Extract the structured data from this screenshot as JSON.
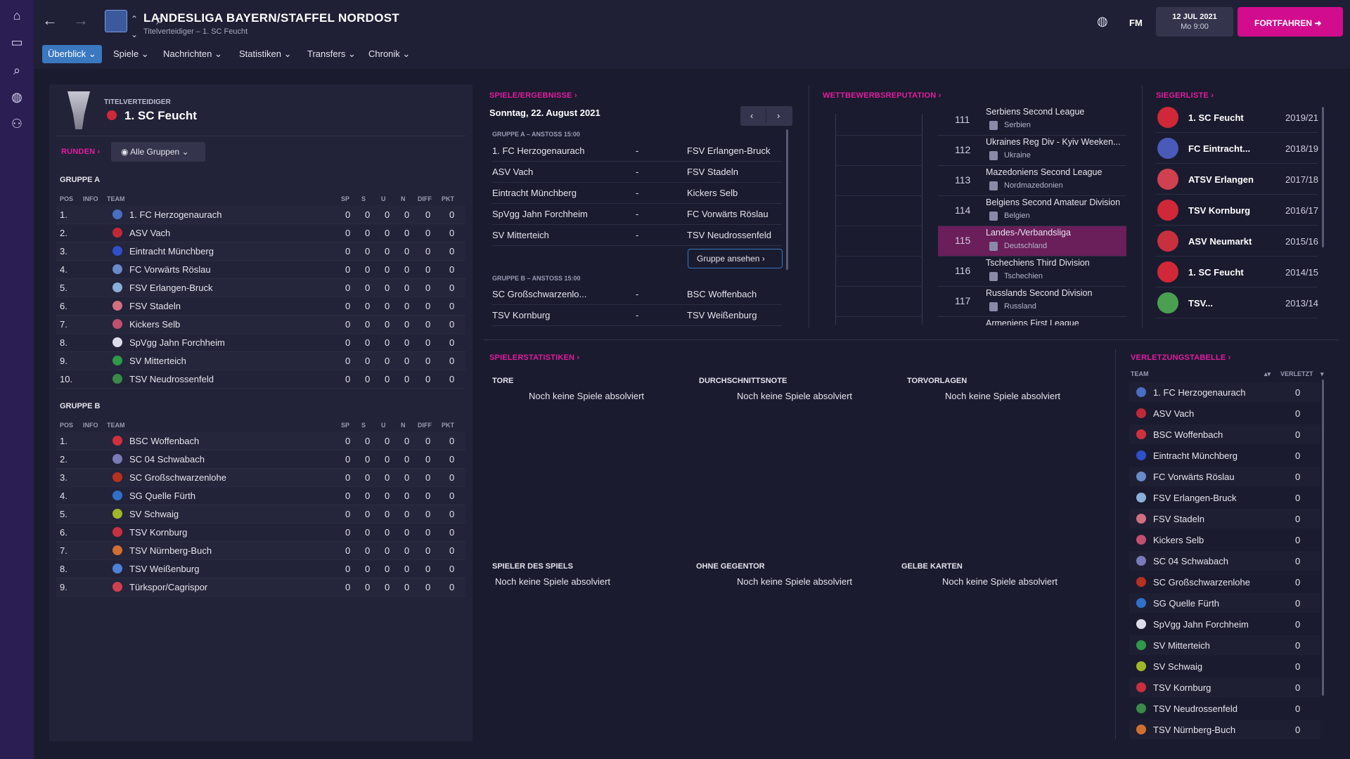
{
  "sidebar": {
    "icons": [
      "home-icon",
      "inbox-icon",
      "search-icon",
      "world-icon",
      "people-icon"
    ]
  },
  "header": {
    "title": "LANDESLIGA BAYERN/STAFFEL NORDOST",
    "subtitle": "Titelverteidiger – 1. SC Feucht",
    "fm_label": "FM",
    "date": "12 JUL 2021",
    "time": "Mo 9:00",
    "continue_label": "FORTFAHREN"
  },
  "menu": [
    "Überblick",
    "Spiele",
    "Nachrichten",
    "Statistiken",
    "Transfers",
    "Chronik"
  ],
  "defender": {
    "label": "TITELVERTEIDIGER",
    "name": "1. SC Feucht"
  },
  "rounds": {
    "label": "RUNDEN",
    "filter": "Alle Gruppen"
  },
  "columns": {
    "pos": "POS",
    "info": "INFO",
    "team": "TEAM",
    "sp": "SP",
    "s": "S",
    "u": "U",
    "n": "N",
    "diff": "DIFF",
    "pkt": "PKT"
  },
  "groupA": {
    "title": "GRUPPE A",
    "rows": [
      {
        "pos": "1.",
        "team": "1. FC Herzogenaurach",
        "v": [
          "0",
          "0",
          "0",
          "0",
          "0",
          "0"
        ],
        "color": "#4a6ec0"
      },
      {
        "pos": "2.",
        "team": "ASV Vach",
        "v": [
          "0",
          "0",
          "0",
          "0",
          "0",
          "0"
        ],
        "color": "#c0283a"
      },
      {
        "pos": "3.",
        "team": "Eintracht Münchberg",
        "v": [
          "0",
          "0",
          "0",
          "0",
          "0",
          "0"
        ],
        "color": "#3050c8"
      },
      {
        "pos": "4.",
        "team": "FC Vorwärts Röslau",
        "v": [
          "0",
          "0",
          "0",
          "0",
          "0",
          "0"
        ],
        "color": "#6a8ac8"
      },
      {
        "pos": "5.",
        "team": "FSV Erlangen-Bruck",
        "v": [
          "0",
          "0",
          "0",
          "0",
          "0",
          "0"
        ],
        "color": "#8ab0d8"
      },
      {
        "pos": "6.",
        "team": "FSV Stadeln",
        "v": [
          "0",
          "0",
          "0",
          "0",
          "0",
          "0"
        ],
        "color": "#d07080"
      },
      {
        "pos": "7.",
        "team": "Kickers Selb",
        "v": [
          "0",
          "0",
          "0",
          "0",
          "0",
          "0"
        ],
        "color": "#c05070"
      },
      {
        "pos": "8.",
        "team": "SpVgg Jahn Forchheim",
        "v": [
          "0",
          "0",
          "0",
          "0",
          "0",
          "0"
        ],
        "color": "#dcdcec"
      },
      {
        "pos": "9.",
        "team": "SV Mitterteich",
        "v": [
          "0",
          "0",
          "0",
          "0",
          "0",
          "0"
        ],
        "color": "#2e9a4a"
      },
      {
        "pos": "10.",
        "team": "TSV Neudrossenfeld",
        "v": [
          "0",
          "0",
          "0",
          "0",
          "0",
          "0"
        ],
        "color": "#3a8a48"
      }
    ]
  },
  "groupB": {
    "title": "GRUPPE B",
    "rows": [
      {
        "pos": "1.",
        "team": "BSC Woffenbach",
        "v": [
          "0",
          "0",
          "0",
          "0",
          "0",
          "0"
        ],
        "color": "#d03040"
      },
      {
        "pos": "2.",
        "team": "SC 04 Schwabach",
        "v": [
          "0",
          "0",
          "0",
          "0",
          "0",
          "0"
        ],
        "color": "#7a7ab8"
      },
      {
        "pos": "3.",
        "team": "SC Großschwarzenlohe",
        "v": [
          "0",
          "0",
          "0",
          "0",
          "0",
          "0"
        ],
        "color": "#b83020"
      },
      {
        "pos": "4.",
        "team": "SG Quelle Fürth",
        "v": [
          "0",
          "0",
          "0",
          "0",
          "0",
          "0"
        ],
        "color": "#3070c8"
      },
      {
        "pos": "5.",
        "team": "SV Schwaig",
        "v": [
          "0",
          "0",
          "0",
          "0",
          "0",
          "0"
        ],
        "color": "#a0b828"
      },
      {
        "pos": "6.",
        "team": "TSV Kornburg",
        "v": [
          "0",
          "0",
          "0",
          "0",
          "0",
          "0"
        ],
        "color": "#c83040"
      },
      {
        "pos": "7.",
        "team": "TSV Nürnberg-Buch",
        "v": [
          "0",
          "0",
          "0",
          "0",
          "0",
          "0"
        ],
        "color": "#d07030"
      },
      {
        "pos": "8.",
        "team": "TSV Weißenburg",
        "v": [
          "0",
          "0",
          "0",
          "0",
          "0",
          "0"
        ],
        "color": "#5080d8"
      },
      {
        "pos": "9.",
        "team": "Türkspor/Cagrispor",
        "v": [
          "0",
          "0",
          "0",
          "0",
          "0",
          "0"
        ],
        "color": "#d04050"
      }
    ]
  },
  "fixtures": {
    "label": "SPIELE/ERGEBNISSE",
    "date": "Sonntag, 22. August 2021",
    "groupA_header": "GRUPPE A – ANSTOSS 15:00",
    "groupB_header": "GRUPPE B – ANSTOSS 15:00",
    "view_group": "Gruppe ansehen",
    "a": [
      {
        "home": "1. FC Herzogenaurach",
        "sep": "-",
        "away": "FSV Erlangen-Bruck"
      },
      {
        "home": "ASV Vach",
        "sep": "-",
        "away": "FSV Stadeln"
      },
      {
        "home": "Eintracht Münchberg",
        "sep": "-",
        "away": "Kickers Selb"
      },
      {
        "home": "SpVgg Jahn Forchheim",
        "sep": "-",
        "away": "FC Vorwärts Röslau"
      },
      {
        "home": "SV Mitterteich",
        "sep": "-",
        "away": "TSV Neudrossenfeld"
      }
    ],
    "b": [
      {
        "home": "SC Großschwarzenlo...",
        "sep": "-",
        "away": "BSC Woffenbach"
      },
      {
        "home": "TSV Kornburg",
        "sep": "-",
        "away": "TSV Weißenburg"
      }
    ]
  },
  "reputation": {
    "label": "WETTBEWERBSREPUTATION",
    "rows": [
      {
        "rank": "111",
        "league": "Serbiens Second League",
        "country": "Serbien"
      },
      {
        "rank": "112",
        "league": "Ukraines Reg Div - Kyiv Weeken...",
        "country": "Ukraine"
      },
      {
        "rank": "113",
        "league": "Mazedoniens Second League",
        "country": "Nordmazedonien"
      },
      {
        "rank": "114",
        "league": "Belgiens Second Amateur Division",
        "country": "Belgien"
      },
      {
        "rank": "115",
        "league": "Landes-/Verbandsliga",
        "country": "Deutschland"
      },
      {
        "rank": "116",
        "league": "Tschechiens Third Division",
        "country": "Tschechien"
      },
      {
        "rank": "117",
        "league": "Russlands Second Division",
        "country": "Russland"
      },
      {
        "rank": "",
        "league": "Armeniens First League",
        "country": ""
      }
    ]
  },
  "winners": {
    "label": "SIEGERLISTE",
    "rows": [
      {
        "team": "1. SC Feucht",
        "season": "2019/21",
        "color": "#d02838"
      },
      {
        "team": "FC Eintracht...",
        "season": "2018/19",
        "color": "#4a5ab8"
      },
      {
        "team": "ATSV Erlangen",
        "season": "2017/18",
        "color": "#d04050"
      },
      {
        "team": "TSV Kornburg",
        "season": "2016/17",
        "color": "#d02838"
      },
      {
        "team": "ASV Neumarkt",
        "season": "2015/16",
        "color": "#c83040"
      },
      {
        "team": "1. SC Feucht",
        "season": "2014/15",
        "color": "#d02838"
      },
      {
        "team": "TSV...",
        "season": "2013/14",
        "color": "#4aa050"
      }
    ]
  },
  "player_stats": {
    "label": "SPIELERSTATISTIKEN",
    "items": [
      {
        "title": "TORE",
        "text": "Noch keine Spiele absolviert"
      },
      {
        "title": "DURCHSCHNITTSNOTE",
        "text": "Noch keine Spiele absolviert"
      },
      {
        "title": "TORVORLAGEN",
        "text": "Noch keine Spiele absolviert"
      },
      {
        "title": "SPIELER DES SPIELS",
        "text": "Noch keine Spiele absolviert"
      },
      {
        "title": "OHNE GEGENTOR",
        "text": "Noch keine Spiele absolviert"
      },
      {
        "title": "GELBE KARTEN",
        "text": "Noch keine Spiele absolviert"
      }
    ]
  },
  "injuries": {
    "label": "VERLETZUNGSTABELLE",
    "col_team": "TEAM",
    "col_injured": "VERLETZT",
    "rows": [
      {
        "team": "1. FC Herzogenaurach",
        "n": "0",
        "color": "#4a6ec0"
      },
      {
        "team": "ASV Vach",
        "n": "0",
        "color": "#c0283a"
      },
      {
        "team": "BSC Woffenbach",
        "n": "0",
        "color": "#d03040"
      },
      {
        "team": "Eintracht Münchberg",
        "n": "0",
        "color": "#3050c8"
      },
      {
        "team": "FC Vorwärts Röslau",
        "n": "0",
        "color": "#6a8ac8"
      },
      {
        "team": "FSV Erlangen-Bruck",
        "n": "0",
        "color": "#8ab0d8"
      },
      {
        "team": "FSV Stadeln",
        "n": "0",
        "color": "#d07080"
      },
      {
        "team": "Kickers Selb",
        "n": "0",
        "color": "#c05070"
      },
      {
        "team": "SC 04 Schwabach",
        "n": "0",
        "color": "#7a7ab8"
      },
      {
        "team": "SC Großschwarzenlohe",
        "n": "0",
        "color": "#b83020"
      },
      {
        "team": "SG Quelle Fürth",
        "n": "0",
        "color": "#3070c8"
      },
      {
        "team": "SpVgg Jahn Forchheim",
        "n": "0",
        "color": "#dcdcec"
      },
      {
        "team": "SV Mitterteich",
        "n": "0",
        "color": "#2e9a4a"
      },
      {
        "team": "SV Schwaig",
        "n": "0",
        "color": "#a0b828"
      },
      {
        "team": "TSV Kornburg",
        "n": "0",
        "color": "#c83040"
      },
      {
        "team": "TSV Neudrossenfeld",
        "n": "0",
        "color": "#3a8a48"
      },
      {
        "team": "TSV Nürnberg-Buch",
        "n": "0",
        "color": "#d07030"
      }
    ]
  },
  "colors": {
    "accent": "#e11da0",
    "active_tab": "#3a78c0",
    "continue": "#d10d8e",
    "highlight_row": "#6a1e5a"
  }
}
